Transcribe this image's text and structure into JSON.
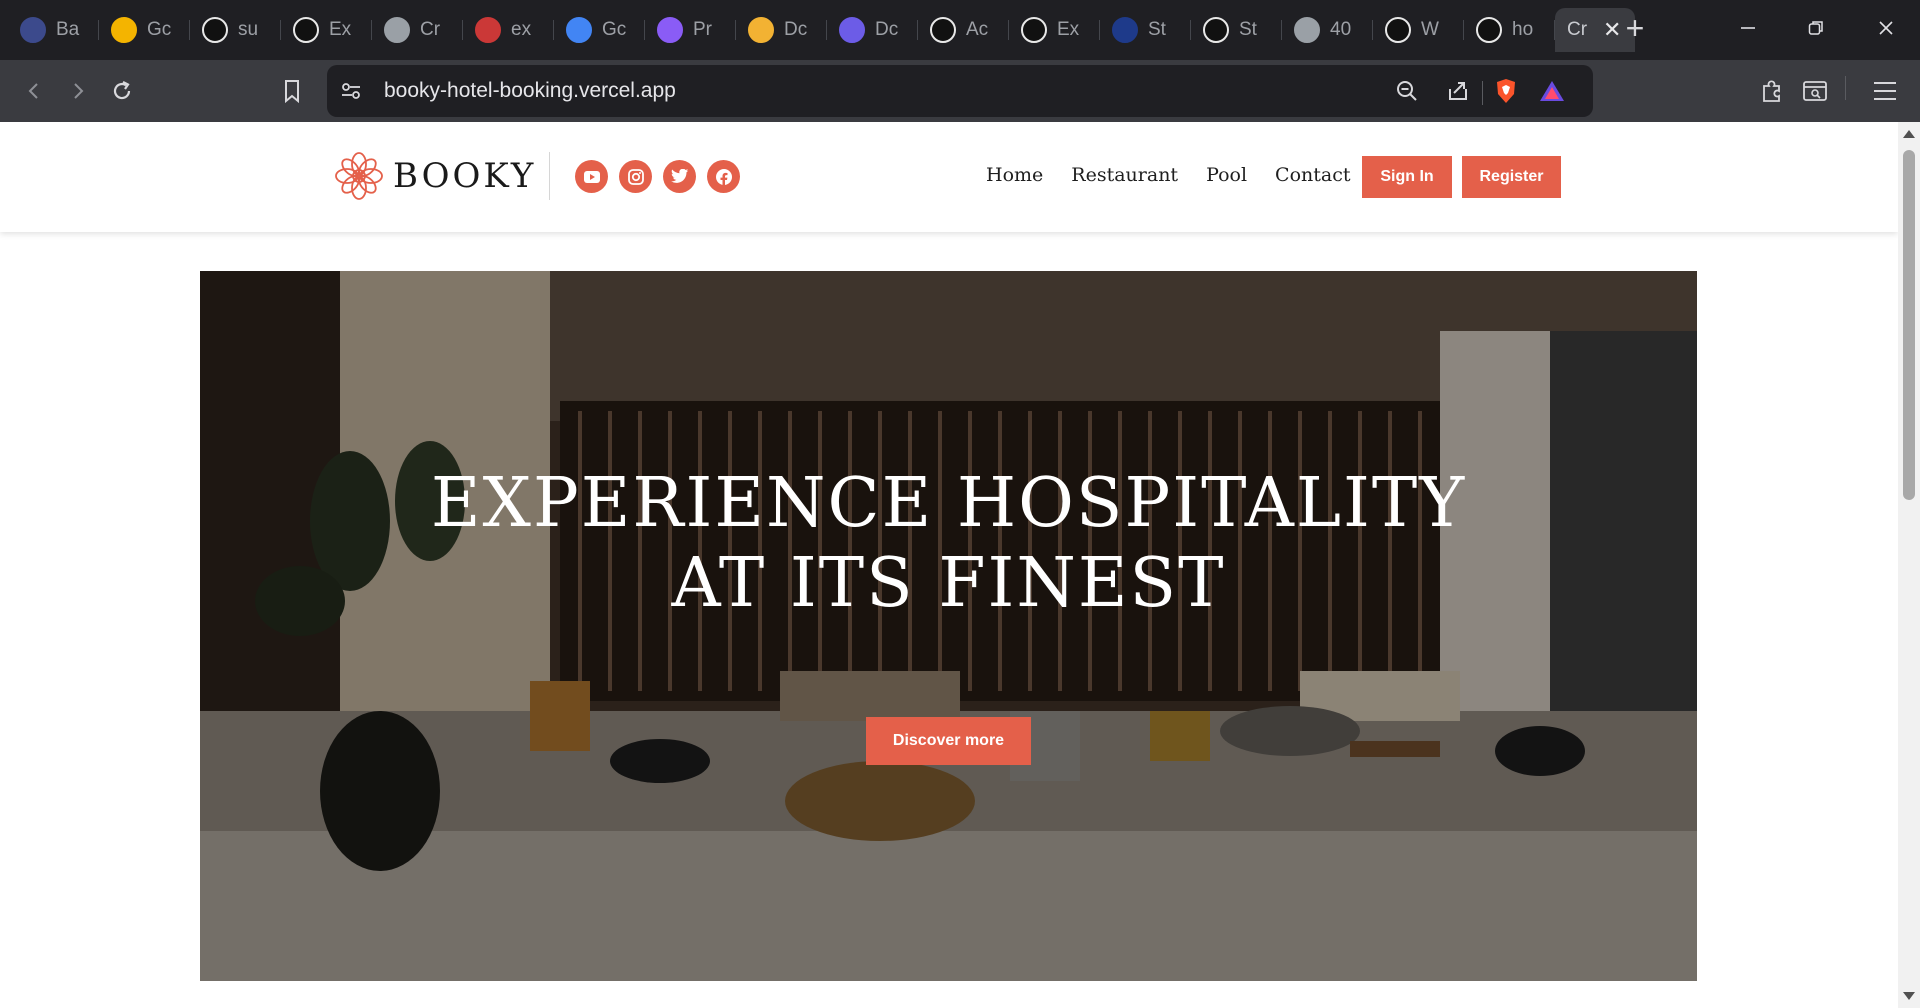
{
  "browser": {
    "tabs": [
      {
        "label": "Ba",
        "icon": "gemini-code-icon",
        "color": "#3c4a8c"
      },
      {
        "label": "Gc",
        "icon": "bulb-icon",
        "color": "#f4b400"
      },
      {
        "label": "su",
        "icon": "github-icon",
        "color": "#ffffff"
      },
      {
        "label": "Ex",
        "icon": "angular-icon",
        "color": "#ffffff"
      },
      {
        "label": "Cr",
        "icon": "craft-icon",
        "color": "#9aa0a6"
      },
      {
        "label": "ex",
        "icon": "npm-icon",
        "color": "#cb3837"
      },
      {
        "label": "Gc",
        "icon": "gemini-icon",
        "color": "#4285f4"
      },
      {
        "label": "Pr",
        "icon": "cube-icon",
        "color": "#8a5cf6"
      },
      {
        "label": "Dc",
        "icon": "box-icon",
        "color": "#f2b233"
      },
      {
        "label": "Dc",
        "icon": "circle-c-icon",
        "color": "#6c5ce7"
      },
      {
        "label": "Ac",
        "icon": "circle-c-icon",
        "color": "#ffffff"
      },
      {
        "label": "Ex",
        "icon": "openai-icon",
        "color": "#ffffff"
      },
      {
        "label": "St",
        "icon": "code-icon",
        "color": "#1e3a8a"
      },
      {
        "label": "St",
        "icon": "github-icon",
        "color": "#ffffff"
      },
      {
        "label": "40",
        "icon": "globe-icon",
        "color": "#9aa0a6"
      },
      {
        "label": "W",
        "icon": "vercel-icon",
        "color": "#ffffff"
      },
      {
        "label": "ho",
        "icon": "vercel-icon",
        "color": "#ffffff"
      }
    ],
    "active_tab": {
      "label": "Cr"
    },
    "url": "booky-hotel-booking.vercel.app"
  },
  "site": {
    "brand": "BOOKY",
    "accent": "#e4604a",
    "social": [
      "youtube-icon",
      "instagram-icon",
      "twitter-icon",
      "facebook-icon"
    ],
    "nav": [
      "Home",
      "Restaurant",
      "Pool",
      "Contact"
    ],
    "sign_in": "Sign In",
    "register": "Register",
    "hero": {
      "line1": "EXPERIENCE HOSPITALITY",
      "line2": "AT ITS FINEST",
      "cta": "Discover more"
    }
  }
}
